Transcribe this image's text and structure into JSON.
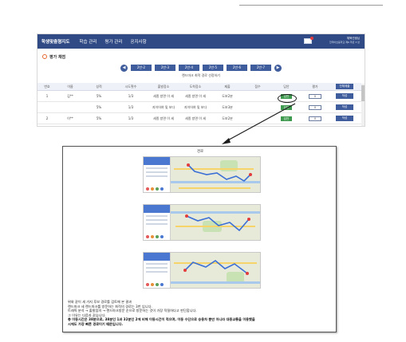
{
  "app": {
    "brand": "학생맞춤형지도",
    "nav": [
      "학습 관리",
      "평가 관리",
      "공지사항"
    ],
    "user": {
      "name": "체육선생님",
      "school": "한국어초등학교 제6 학년 3 반"
    },
    "section_title": "평가 채점",
    "class_tabs": [
      "2반-2",
      "2반-3",
      "2반-4",
      "2반-5",
      "2반-6",
      "2반-7"
    ],
    "subtitle": "랜드마크 최적 경로 선정하기",
    "table": {
      "headers": [
        "번호",
        "이름",
        "성적",
        "시도횟수",
        "출발장소",
        "도착장소",
        "제출",
        "점수",
        "답안",
        "평가",
        "전체제출"
      ],
      "rows": [
        {
          "no": "1",
          "name": "김**",
          "grade": "5%",
          "tries": "1/3",
          "from": "세종 방면 이 세",
          "to": "세종 방면 이 세",
          "submit": "도보2분",
          "score": "",
          "answer": "답안",
          "eval": "0",
          "action": "작성"
        },
        {
          "no": "",
          "name": "",
          "grade": "5%",
          "tries": "1/3",
          "from": "지이어여 및 보다",
          "to": "지이어여 및 보다",
          "submit": "도보3분",
          "score": "",
          "answer": "답안",
          "eval": "0",
          "action": "작성"
        },
        {
          "no": "2",
          "name": "이**",
          "grade": "5%",
          "tries": "1/3",
          "from": "세종 방면 이 세",
          "to": "세종 방면 이 세",
          "submit": "도보2분",
          "score": "",
          "answer": "답안",
          "eval": "0",
          "action": "작성"
        }
      ],
      "bulk_button": "전체제출"
    }
  },
  "report": {
    "title": "경로",
    "text_lines": [
      "위와 같이 세 가지 후보 경로를 검토해 본 결과",
      "랜드마크 세 랜드마크를 방문하는 최적의 경로는 3번 입니다.",
      "트래픽 분석 → 출발점의 → 랜드마크방문 순으로 방문하는 것이 가장 적절하다고 판단합니다.",
      "그 이유는 다음과 같습니다.",
      "총 이동시간은 38분으로, 38분인 1과 32분인 2에 비해 이동시간이 적으며, 이동 수단으로 승용차 뿐만 아니라 대중교통을 이용했을",
      "시에도 가장 빠른 경로이기 때문입니다."
    ]
  },
  "colors": {
    "navbar": "#2f4a85",
    "primary": "#3f5c9c",
    "success": "#3e9a4f",
    "section_icon": "#e4682f"
  }
}
